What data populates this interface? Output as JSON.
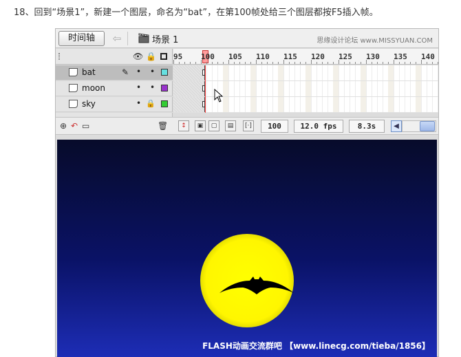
{
  "instruction": "18、回到“场景1”，新建一个图层，命名为“bat”，在第100帧处给三个图层都按F5插入帧。",
  "toolbar": {
    "timeline_button": "时间轴",
    "back_icon": "arrow-left-icon",
    "scene_label": "场景 1",
    "watermark": "思缘设计论坛 www.MISSYUAN.COM"
  },
  "timeline": {
    "ruler_numbers": [
      "95",
      "100",
      "105",
      "110",
      "115",
      "120",
      "125",
      "130",
      "135",
      "140"
    ],
    "current_frame_marker": "100",
    "layers": [
      {
        "name": "bat",
        "selected": true,
        "editing": true,
        "locked": false,
        "color": "#66e0e0"
      },
      {
        "name": "moon",
        "selected": false,
        "editing": false,
        "locked": false,
        "color": "#9933cc"
      },
      {
        "name": "sky",
        "selected": false,
        "editing": false,
        "locked": true,
        "color": "#33cc33"
      }
    ]
  },
  "status": {
    "current_frame": "100",
    "fps": "12.0 fps",
    "elapsed": "8.3s"
  },
  "stage": {
    "footer": "FLASH动画交流群吧 【www.linecg.com/tieba/1856】"
  },
  "colors": {
    "moon": "#ffff00",
    "sky_top": "#070b2a",
    "sky_bottom": "#1d2db6",
    "playhead": "#ff9d9d"
  }
}
